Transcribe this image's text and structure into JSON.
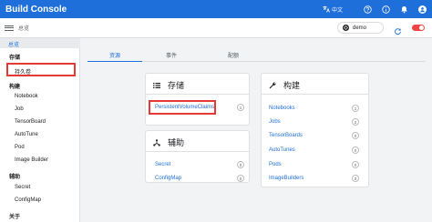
{
  "app": {
    "title": "Build Console"
  },
  "appbar": {
    "language": "中文"
  },
  "subbar": {
    "breadcrumb": "总览",
    "namespace": "demo"
  },
  "sidebar": {
    "home": "总览",
    "sections": [
      {
        "label": "存储",
        "items": [
          "持久卷"
        ]
      },
      {
        "label": "构建",
        "items": [
          "Notebook",
          "Job",
          "TensorBoard",
          "AutoTune",
          "Pod",
          "Image Builder"
        ]
      },
      {
        "label": "辅助",
        "items": [
          "Secret",
          "ConfigMap"
        ]
      },
      {
        "label": "关于",
        "items": []
      }
    ]
  },
  "tabs": [
    "资源",
    "事件",
    "配额"
  ],
  "cards": {
    "storage": {
      "title": "存储",
      "rows": [
        {
          "label": "PersistentVolumeClaims",
          "count": "1"
        }
      ]
    },
    "aux": {
      "title": "辅助",
      "rows": [
        {
          "label": "Secret",
          "count": "0"
        },
        {
          "label": "ConfigMap",
          "count": "0"
        }
      ]
    },
    "build": {
      "title": "构建",
      "rows": [
        {
          "label": "Notebooks",
          "count": "1"
        },
        {
          "label": "Jobs",
          "count": "2"
        },
        {
          "label": "TensorBoards",
          "count": "0"
        },
        {
          "label": "AutoTunes",
          "count": "0"
        },
        {
          "label": "Pods",
          "count": "0"
        },
        {
          "label": "ImageBuilders",
          "count": "0"
        }
      ]
    }
  },
  "colors": {
    "primary": "#1e6fd9",
    "highlight": "#e53935",
    "toggle": "#ef4444"
  }
}
